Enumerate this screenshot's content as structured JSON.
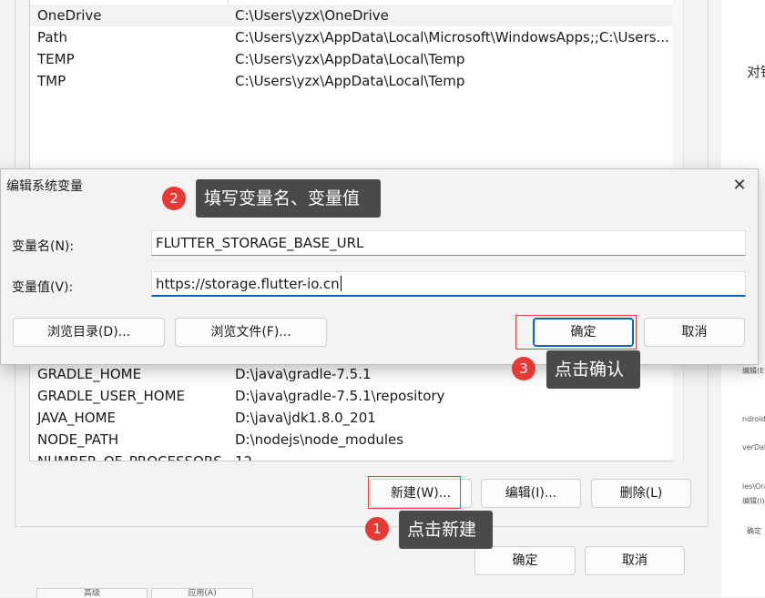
{
  "background": {
    "right_text": "对镜像,",
    "right_mini": [
      "编辑(E)",
      "ndroid\\Sd",
      "verData",
      "les\\Oracle\\Java",
      "编辑(I)",
      "确定"
    ],
    "list_top": [
      {
        "name": "OneDrive",
        "value": "C:\\Users\\yzx\\OneDrive"
      },
      {
        "name": "Path",
        "value": "C:\\Users\\yzx\\AppData\\Local\\Microsoft\\WindowsApps;;C:\\Users..."
      },
      {
        "name": "TEMP",
        "value": "C:\\Users\\yzx\\AppData\\Local\\Temp"
      },
      {
        "name": "TMP",
        "value": "C:\\Users\\yzx\\AppData\\Local\\Temp"
      }
    ],
    "list_bottom": [
      {
        "name": "GRADLE_HOME",
        "value": "D:\\java\\gradle-7.5.1"
      },
      {
        "name": "GRADLE_USER_HOME",
        "value": "D:\\java\\gradle-7.5.1\\repository"
      },
      {
        "name": "JAVA_HOME",
        "value": "D:\\java\\jdk1.8.0_201"
      },
      {
        "name": "NODE_PATH",
        "value": "D:\\nodejs\\node_modules"
      },
      {
        "name": "NUMBER_OF_PROCESSORS",
        "value": "12"
      }
    ],
    "buttons": {
      "new": "新建(W)...",
      "edit": "编辑(I)...",
      "delete": "删除(L)"
    },
    "footer": {
      "ok": "确定",
      "cancel": "取消"
    },
    "tabs": [
      "高级",
      "应用(A)"
    ]
  },
  "dialog": {
    "title": "编辑系统变量",
    "close_glyph": "✕",
    "name_label": "变量名(N):",
    "name_value": "FLUTTER_STORAGE_BASE_URL",
    "value_label": "变量值(V):",
    "value_value": "https://storage.flutter-io.cn",
    "browse_dir": "浏览目录(D)...",
    "browse_file": "浏览文件(F)...",
    "ok": "确定",
    "cancel": "取消"
  },
  "annotations": [
    {
      "number": "1",
      "text": "点击新建"
    },
    {
      "number": "2",
      "text": "填写变量名、变量值"
    },
    {
      "number": "3",
      "text": "点击确认"
    }
  ],
  "colors": {
    "accent": "#0067c0",
    "annotation_red": "#e53935",
    "callout_bg": "#4a4a4a"
  }
}
